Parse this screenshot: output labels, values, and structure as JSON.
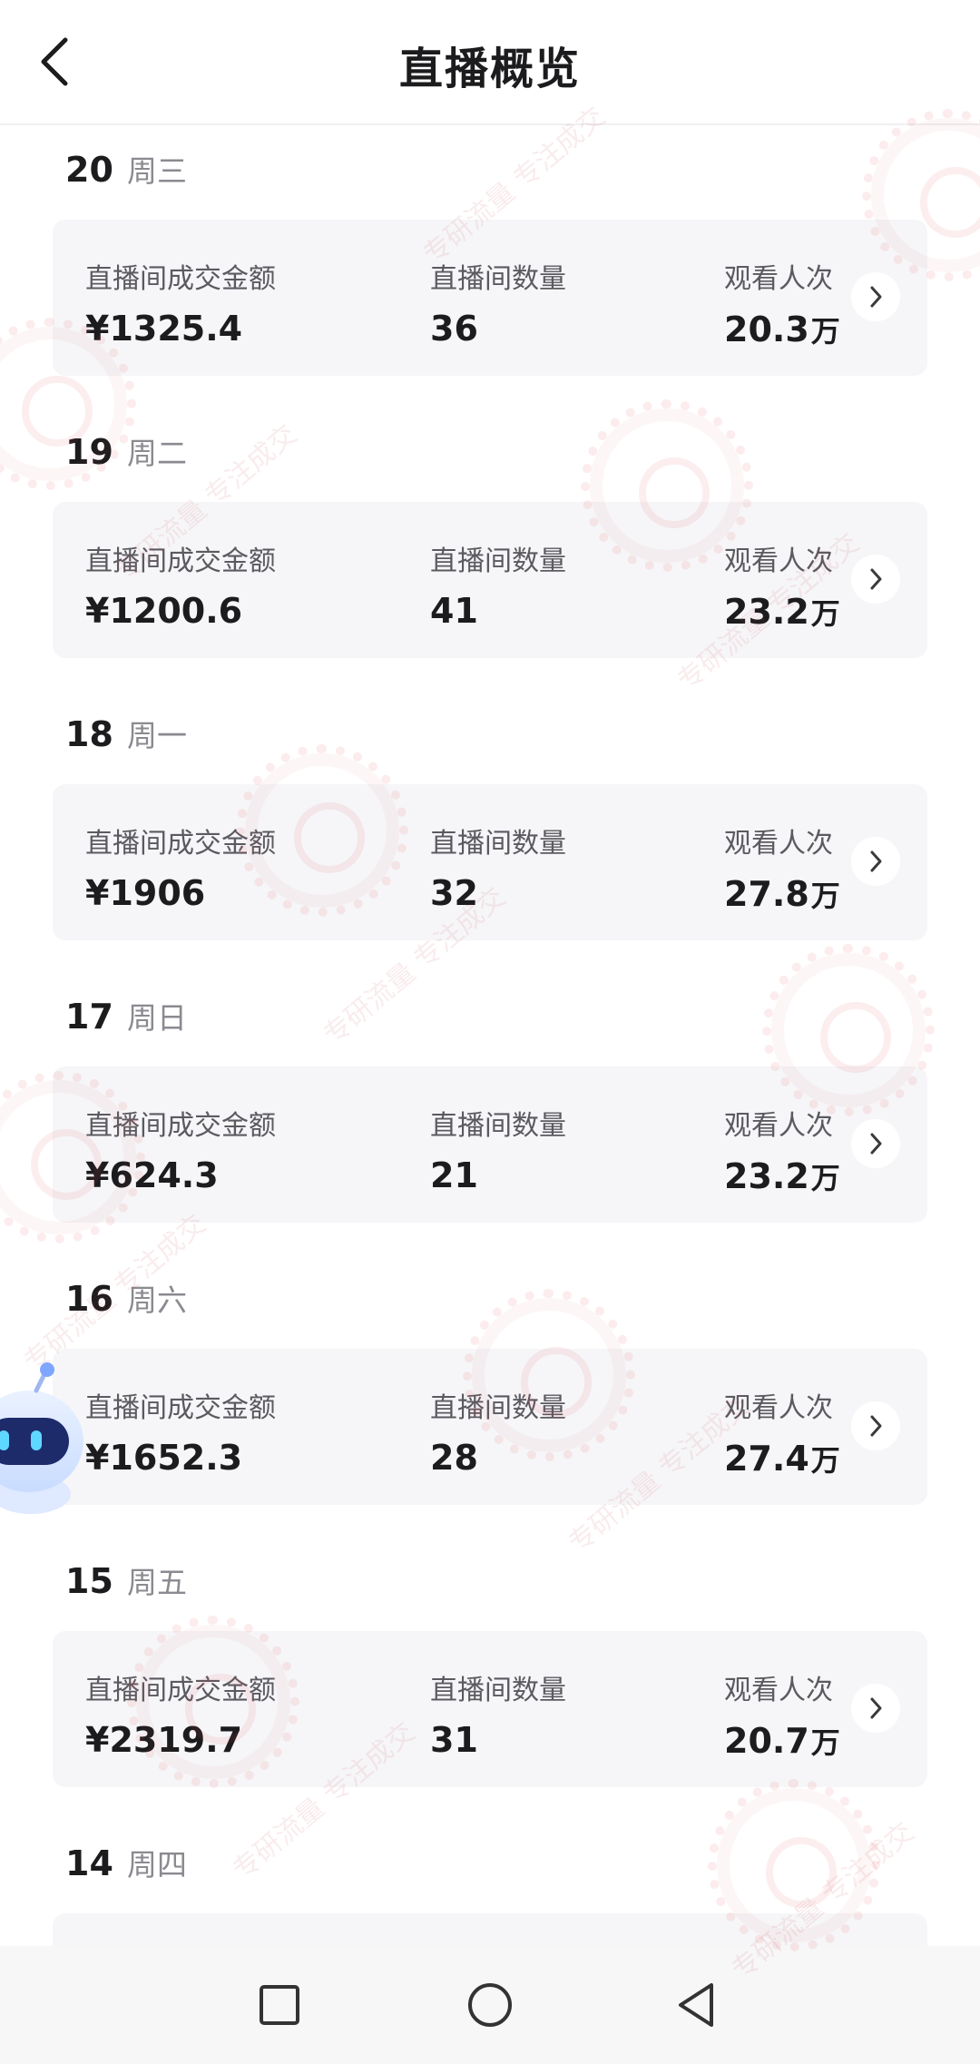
{
  "header": {
    "title": "直播概览",
    "back_icon": "chevron-left-icon"
  },
  "labels": {
    "amount": "直播间成交金额",
    "count": "直播间数量",
    "views": "观看人次"
  },
  "days": [
    {
      "day": "20",
      "weekday": "周三",
      "amount": "¥1325.4",
      "count": "36",
      "views": "20.3",
      "views_unit": "万"
    },
    {
      "day": "19",
      "weekday": "周二",
      "amount": "¥1200.6",
      "count": "41",
      "views": "23.2",
      "views_unit": "万"
    },
    {
      "day": "18",
      "weekday": "周一",
      "amount": "¥1906",
      "count": "32",
      "views": "27.8",
      "views_unit": "万"
    },
    {
      "day": "17",
      "weekday": "周日",
      "amount": "¥624.3",
      "count": "21",
      "views": "23.2",
      "views_unit": "万"
    },
    {
      "day": "16",
      "weekday": "周六",
      "amount": "¥1652.3",
      "count": "28",
      "views": "27.4",
      "views_unit": "万"
    },
    {
      "day": "15",
      "weekday": "周五",
      "amount": "¥2319.7",
      "count": "31",
      "views": "20.7",
      "views_unit": "万"
    },
    {
      "day": "14",
      "weekday": "周四"
    }
  ],
  "watermark": {
    "text": "专研流量 专注成交"
  },
  "nav": {
    "recent_icon": "square-icon",
    "home_icon": "circle-icon",
    "back_icon": "triangle-back-icon"
  },
  "colors": {
    "card_bg": "#f6f6f8",
    "text_primary": "#1c1c1e",
    "text_secondary": "#8a8a90",
    "watermark": "#dc4650"
  }
}
